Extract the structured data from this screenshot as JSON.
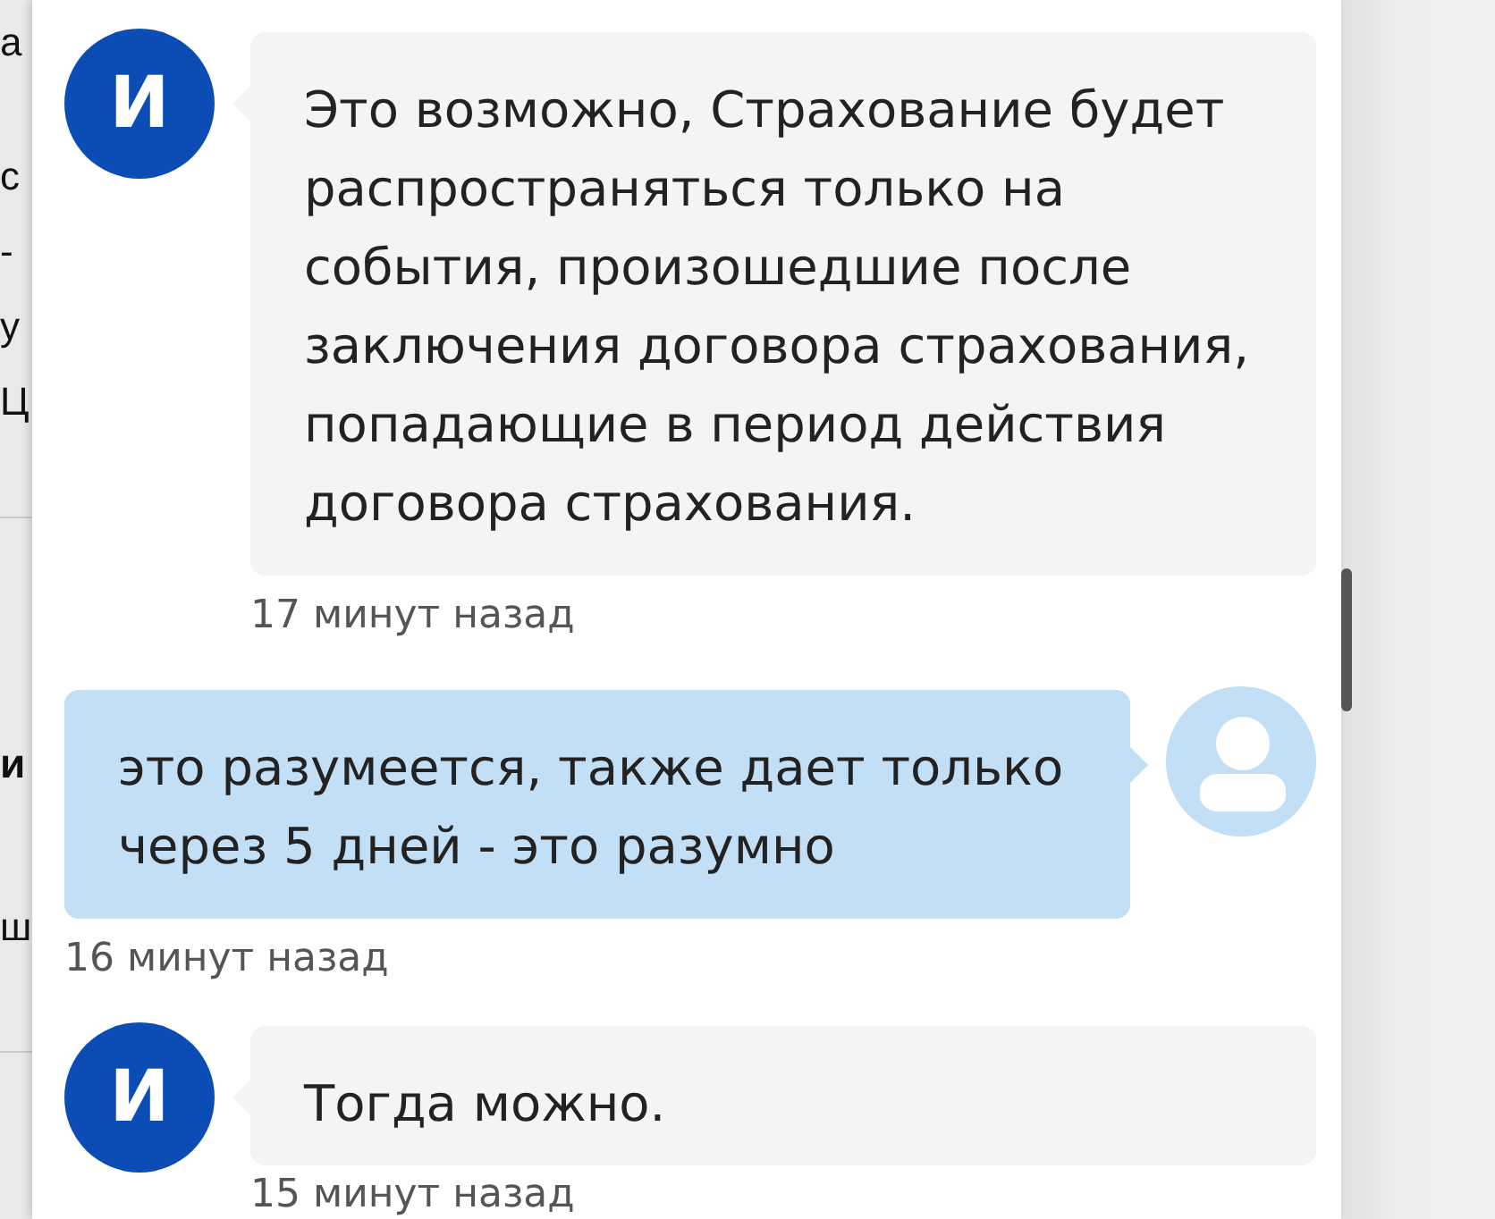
{
  "background_page": {
    "sections": [
      {
        "lines": [
          {
            "text": "а",
            "bold": false
          },
          {
            "text": "с",
            "bold": false
          },
          {
            "text": "-",
            "bold": false
          },
          {
            "text": "у",
            "bold": false
          },
          {
            "text": "Ц",
            "bold": false
          }
        ]
      },
      {
        "lines": [
          {
            "text": "и",
            "bold": true
          },
          {
            "text": "ш",
            "bold": false
          }
        ]
      }
    ]
  },
  "messages": [
    {
      "kind": "incoming",
      "avatar_letter": "И",
      "text": "Это возможно, Страхование будет\nраспространяться только на\nсобытия, произошедшие после\nзаключения договора страхования,\nпопадающие в период действия\nдоговора страхования.",
      "time": "17 минут назад"
    },
    {
      "kind": "outgoing",
      "text": "это разумеется, также дает только\nчерез 5 дней - это разумно",
      "time": "16 минут назад"
    },
    {
      "kind": "incoming",
      "avatar_letter": "И",
      "text": "Тогда можно.",
      "time": "15 минут назад"
    }
  ]
}
